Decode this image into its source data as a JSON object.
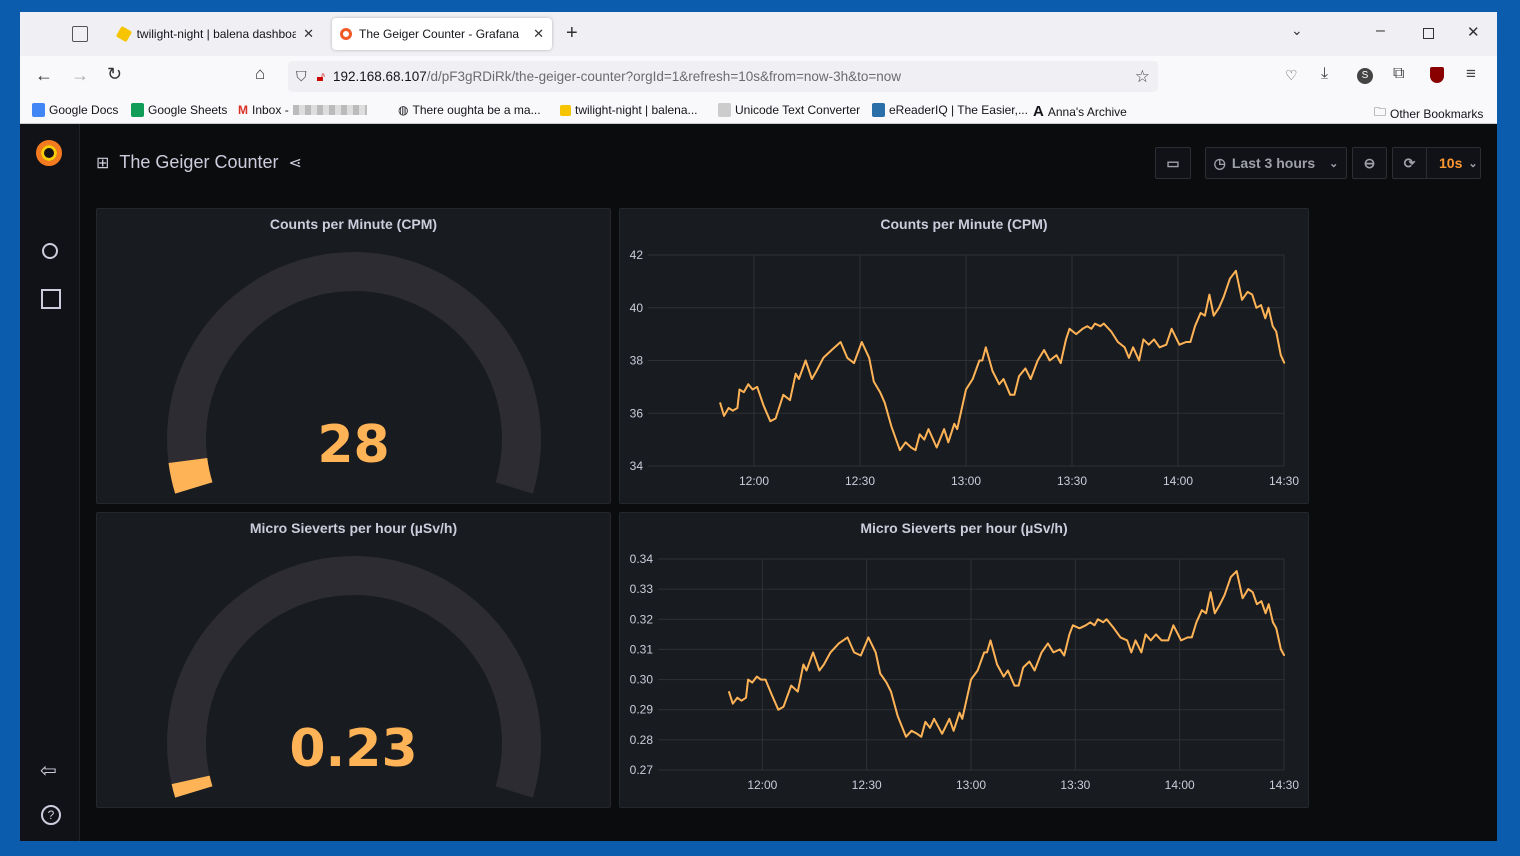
{
  "browser": {
    "tabs": [
      {
        "label": "twilight-night | balena dashboa",
        "active": false
      },
      {
        "label": "The Geiger Counter - Grafana",
        "active": true
      }
    ],
    "url_host": "192.168.68.107",
    "url_path": "/d/pF3gRDiRk/the-geiger-counter?orgId=1&refresh=10s&from=now-3h&to=now",
    "bookmarks": [
      "Google Docs",
      "Google Sheets",
      "Inbox -",
      "There oughta be a ma...",
      "twilight-night | balena...",
      "Unicode Text Converter",
      "eReaderIQ | The Easier,...",
      "Anna's Archive"
    ],
    "other_bookmarks": "Other Bookmarks"
  },
  "grafana": {
    "dashboard_title": "The Geiger Counter",
    "time_range": "Last 3 hours",
    "refresh": "10s",
    "accent": "#ffb357",
    "refresh_color": "#ff9830"
  },
  "panels": {
    "gauge_cpm": {
      "title": "Counts per Minute (CPM)",
      "value": "28",
      "fill_fraction": 0.045
    },
    "gauge_usv": {
      "title": "Micro Sieverts per hour (µSv/h)",
      "value": "0.23",
      "fill_fraction": 0.02
    }
  },
  "chart_data": [
    {
      "type": "line",
      "title": "Counts per Minute (CPM)",
      "color": "#ffb357",
      "xlim": [
        "11:30",
        "14:30"
      ],
      "ylim": [
        34,
        42
      ],
      "grid": true,
      "yticks": [
        "34",
        "36",
        "38",
        "40",
        "42"
      ],
      "xticks": [
        "12:00",
        "12:30",
        "13:00",
        "13:30",
        "14:00",
        "14:30"
      ],
      "x": [
        "11:50:24",
        "11:51:30",
        "11:52:48",
        "11:54:00",
        "11:55:18",
        "11:55:54",
        "11:57:06",
        "11:58:24",
        "11:59:36",
        "12:00:54",
        "12:02:42",
        "12:04:36",
        "12:06:06",
        "12:08:18",
        "12:10:12",
        "12:11:48",
        "12:12:42",
        "12:14:36",
        "12:16:24",
        "12:17:42",
        "12:19:36",
        "12:22:00",
        "12:24:30",
        "12:26:24",
        "12:28:18",
        "12:30:30",
        "12:32:36",
        "12:33:54",
        "12:35:42",
        "12:37:00",
        "12:38:54",
        "12:41:18",
        "12:42:54",
        "12:44:30",
        "12:45:42",
        "12:46:54",
        "12:48:12",
        "12:49:24",
        "12:51:42",
        "12:53:48",
        "12:55:00",
        "12:56:42",
        "12:57:30",
        "13:00:00",
        "13:01:54",
        "13:03:48",
        "13:04:36",
        "13:05:36",
        "13:07:30",
        "13:09:24",
        "13:10:36",
        "13:12:30",
        "13:13:42",
        "13:15:00",
        "13:16:48",
        "13:18:18",
        "13:20:18",
        "13:22:06",
        "13:23:42",
        "13:25:36",
        "13:26:48",
        "13:28:18",
        "13:29:18",
        "13:31:12",
        "13:33:00",
        "13:34:18",
        "13:35:30",
        "13:36:30",
        "13:38:00",
        "13:39:00",
        "13:41:06",
        "13:43:00",
        "13:44:54",
        "13:46:06",
        "13:47:18",
        "13:49:00",
        "13:50:12",
        "13:51:42",
        "13:53:12",
        "13:54:48",
        "13:56:42",
        "13:58:12",
        "14:00:24",
        "14:02:18",
        "14:03:30",
        "14:04:48",
        "14:06:24",
        "14:07:36",
        "14:08:54",
        "14:10:06",
        "14:11:36",
        "14:12:54",
        "14:14:42",
        "14:16:24",
        "14:18:06",
        "14:19:42",
        "14:21:00",
        "14:22:12",
        "14:23:30",
        "14:24:42",
        "14:25:36",
        "14:26:48",
        "14:27:48",
        "14:29:06",
        "14:30:06"
      ],
      "values": [
        36.4,
        35.9,
        36.2,
        36.1,
        36.2,
        36.9,
        36.8,
        37.1,
        36.9,
        37.0,
        36.3,
        35.7,
        35.8,
        36.7,
        36.5,
        37.5,
        37.3,
        38.0,
        37.3,
        37.6,
        38.1,
        38.4,
        38.7,
        38.1,
        37.9,
        38.7,
        38.1,
        37.2,
        36.8,
        36.4,
        35.5,
        34.6,
        34.9,
        34.7,
        34.6,
        35.2,
        35.0,
        35.4,
        34.7,
        35.4,
        34.9,
        35.6,
        35.4,
        36.9,
        37.3,
        38.0,
        38.0,
        38.5,
        37.6,
        37.1,
        37.3,
        36.7,
        36.7,
        37.4,
        37.7,
        37.3,
        38.0,
        38.4,
        38.0,
        38.2,
        37.9,
        38.8,
        39.2,
        39.0,
        39.2,
        39.3,
        39.2,
        39.4,
        39.3,
        39.4,
        39.1,
        38.7,
        38.5,
        38.1,
        38.5,
        38.0,
        38.8,
        38.6,
        38.8,
        38.5,
        38.6,
        39.2,
        38.6,
        38.7,
        38.7,
        39.3,
        39.8,
        39.7,
        40.5,
        39.7,
        40.0,
        40.4,
        41.1,
        41.4,
        40.3,
        40.6,
        40.5,
        40.0,
        40.1,
        39.6,
        40.0,
        39.3,
        39.1,
        38.2,
        37.9
      ]
    },
    {
      "type": "line",
      "title": "Micro Sieverts per hour (µSv/h)",
      "color": "#ffb357",
      "xlim": [
        "11:30",
        "14:30"
      ],
      "ylim": [
        0.27,
        0.34
      ],
      "grid": true,
      "yticks": [
        "0.27",
        "0.28",
        "0.29",
        "0.30",
        "0.31",
        "0.32",
        "0.33",
        "0.34"
      ],
      "xticks": [
        "12:00",
        "12:30",
        "13:00",
        "13:30",
        "14:00",
        "14:30"
      ],
      "x": [
        "11:50:24",
        "11:51:30",
        "11:52:48",
        "11:54:00",
        "11:55:18",
        "11:55:54",
        "11:57:06",
        "11:58:24",
        "11:59:36",
        "12:00:54",
        "12:02:42",
        "12:04:36",
        "12:06:06",
        "12:08:18",
        "12:10:12",
        "12:11:48",
        "12:12:42",
        "12:14:36",
        "12:16:24",
        "12:17:42",
        "12:19:36",
        "12:22:00",
        "12:24:30",
        "12:26:24",
        "12:28:18",
        "12:30:30",
        "12:32:36",
        "12:33:54",
        "12:35:42",
        "12:37:00",
        "12:38:54",
        "12:41:18",
        "12:42:54",
        "12:44:30",
        "12:45:42",
        "12:46:54",
        "12:48:12",
        "12:49:24",
        "12:51:42",
        "12:53:48",
        "12:55:00",
        "12:56:42",
        "12:57:30",
        "13:00:00",
        "13:01:54",
        "13:03:48",
        "13:04:36",
        "13:05:36",
        "13:07:30",
        "13:09:24",
        "13:10:36",
        "13:12:30",
        "13:13:42",
        "13:15:00",
        "13:16:48",
        "13:18:18",
        "13:20:18",
        "13:22:06",
        "13:23:42",
        "13:25:36",
        "13:26:48",
        "13:28:18",
        "13:29:18",
        "13:31:12",
        "13:33:00",
        "13:34:18",
        "13:35:30",
        "13:36:30",
        "13:38:00",
        "13:39:00",
        "13:41:06",
        "13:43:00",
        "13:44:54",
        "13:46:06",
        "13:47:18",
        "13:49:00",
        "13:50:12",
        "13:51:42",
        "13:53:12",
        "13:54:48",
        "13:56:42",
        "13:58:12",
        "14:00:24",
        "14:02:18",
        "14:03:30",
        "14:04:48",
        "14:06:24",
        "14:07:36",
        "14:08:54",
        "14:10:06",
        "14:11:36",
        "14:12:54",
        "14:14:42",
        "14:16:24",
        "14:18:06",
        "14:19:42",
        "14:21:00",
        "14:22:12",
        "14:23:30",
        "14:24:42",
        "14:25:36",
        "14:26:48",
        "14:27:48",
        "14:29:06",
        "14:30:06"
      ],
      "values": [
        0.296,
        0.292,
        0.294,
        0.293,
        0.294,
        0.3,
        0.299,
        0.301,
        0.3,
        0.3,
        0.295,
        0.29,
        0.291,
        0.298,
        0.296,
        0.305,
        0.303,
        0.309,
        0.303,
        0.305,
        0.309,
        0.312,
        0.314,
        0.309,
        0.308,
        0.314,
        0.309,
        0.302,
        0.299,
        0.296,
        0.288,
        0.281,
        0.283,
        0.282,
        0.281,
        0.286,
        0.284,
        0.287,
        0.282,
        0.287,
        0.283,
        0.289,
        0.287,
        0.3,
        0.303,
        0.309,
        0.309,
        0.313,
        0.305,
        0.301,
        0.303,
        0.298,
        0.298,
        0.304,
        0.306,
        0.303,
        0.309,
        0.312,
        0.309,
        0.31,
        0.308,
        0.315,
        0.318,
        0.317,
        0.318,
        0.319,
        0.318,
        0.32,
        0.319,
        0.32,
        0.317,
        0.314,
        0.313,
        0.309,
        0.313,
        0.309,
        0.315,
        0.313,
        0.315,
        0.313,
        0.313,
        0.318,
        0.313,
        0.314,
        0.314,
        0.319,
        0.323,
        0.322,
        0.329,
        0.322,
        0.325,
        0.328,
        0.334,
        0.336,
        0.327,
        0.33,
        0.329,
        0.325,
        0.326,
        0.322,
        0.325,
        0.319,
        0.317,
        0.31,
        0.308
      ]
    }
  ]
}
